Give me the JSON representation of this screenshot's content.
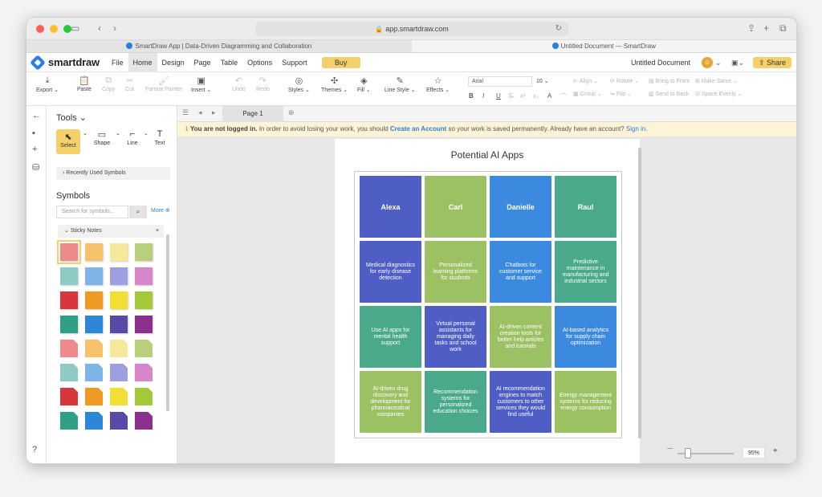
{
  "browser": {
    "url": "app.smartdraw.com",
    "tabs": [
      {
        "label": "SmartDraw App | Data-Driven Diagramming and Collaboration"
      },
      {
        "label": "Untitled Document — SmartDraw"
      }
    ]
  },
  "app": {
    "logo": "smartdraw",
    "menus": [
      "File",
      "Home",
      "Design",
      "Page",
      "Table",
      "Options",
      "Support"
    ],
    "buy_label": "Buy",
    "doc_title": "Untitled Document",
    "share_label": "Share"
  },
  "ribbon": {
    "export": "Export",
    "paste": "Paste",
    "copy": "Copy",
    "cut": "Cut",
    "format_painter": "Format Painter",
    "insert": "Insert",
    "undo": "Undo",
    "redo": "Redo",
    "styles": "Styles",
    "themes": "Themes",
    "fill": "Fill",
    "line_style": "Line Style",
    "effects": "Effects",
    "font": "Arial",
    "font_size": "10",
    "align": "Align",
    "group": "Group",
    "rotate": "Rotate",
    "flip": "Flip",
    "bring_to_front": "Bring to Front",
    "send_to_back": "Send to Back",
    "make_same": "Make Same",
    "space_evenly": "Space Evenly"
  },
  "tools": {
    "header": "Tools",
    "select": "Select",
    "shape": "Shape",
    "line": "Line",
    "text": "Text",
    "recent": "Recently Used Symbols"
  },
  "symbols": {
    "header": "Symbols",
    "search_placeholder": "Search for symbols...",
    "more": "More",
    "library": "Sticky Notes",
    "colors": [
      "#ee8a8a",
      "#f5c16a",
      "#f6ea9a",
      "#b9cf7c",
      "#8ecbc4",
      "#7fb4e8",
      "#9e9fe0",
      "#d786c9",
      "#d8363a",
      "#f09a26",
      "#f3de33",
      "#a3c93a",
      "#2f9f86",
      "#2e86d8",
      "#5a4aa8",
      "#8c2f8d"
    ]
  },
  "pages": {
    "page1": "Page 1"
  },
  "banner": {
    "warning": "You are not logged in.",
    "text1": "In order to avoid losing your work, you should",
    "link": "Create an Account",
    "text2": "so your work is saved permanently. Already have an account?",
    "signin": "Sign in."
  },
  "diagram": {
    "title": "Potential AI Apps",
    "headers": [
      "Alexa",
      "Carl",
      "Danielle",
      "Raul"
    ],
    "rows": [
      [
        "Medical diagnostics for early disease detection",
        "Personalized learning platforms for students",
        "Chatbots for customer service and support",
        "Predictive maintenance in manufacturing and industrial sectors"
      ],
      [
        "Use AI apps for mental health support",
        "Virtual personal assistants for managing daily tasks and school work",
        "AI-driven content creation tools for better help articles and tutorials",
        "AI-based analytics for supply chain optimization"
      ],
      [
        "AI-driven drug discovery and development for pharmaceutical companies",
        "Recommendation systems for personalized education choices",
        "AI recommendation engines to match customers to other services they would find useful",
        "Energy management systems for reducing energy consumption"
      ]
    ],
    "colors": {
      "blue_dark": "#4f5ec4",
      "green_light": "#9cc163",
      "blue": "#3c8ae0",
      "teal": "#4aa98b"
    }
  },
  "zoom": {
    "percent": "95%"
  }
}
